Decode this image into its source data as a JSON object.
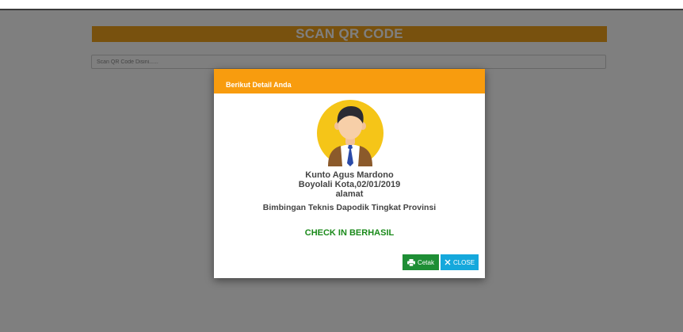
{
  "page": {
    "title": "SCAN QR CODE",
    "scan_placeholder": "Scan QR Code Disini......"
  },
  "modal": {
    "header": "Berikut Detail Anda",
    "name": "Kunto Agus Mardono",
    "birth": "Boyolali Kota,02/01/2019",
    "address": "alamat",
    "event": "Bimbingan Teknis Dapodik Tingkat Provinsi",
    "status": "CHECK IN BERHASIL",
    "buttons": {
      "print_label": "Cetak",
      "close_label": "CLOSE"
    }
  },
  "colors": {
    "title_bar": "#f0a21d",
    "modal_header": "#f89c0e",
    "success_text": "#1a8a1a",
    "print_button": "#1e8e35",
    "close_button": "#15a8dc"
  }
}
